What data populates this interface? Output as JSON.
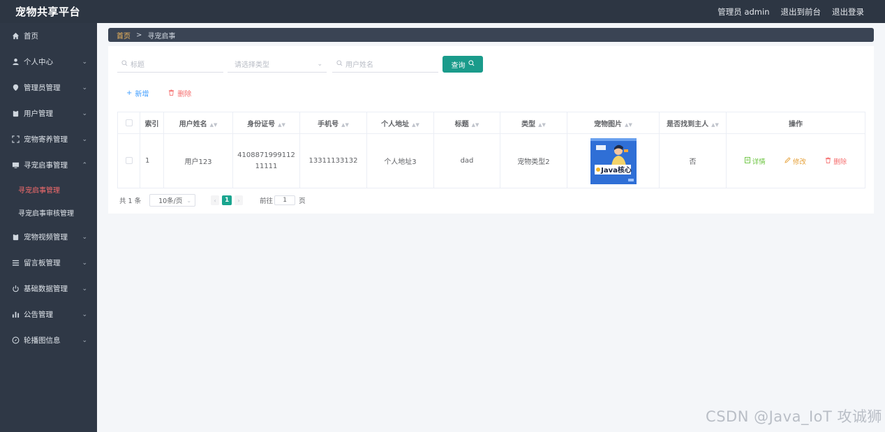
{
  "header": {
    "brand": "宠物共享平台",
    "user": "管理员 admin",
    "front": "退出到前台",
    "logout": "退出登录"
  },
  "sidebar": {
    "items": [
      {
        "label": "首页",
        "icon": "home-icon"
      },
      {
        "label": "个人中心",
        "icon": "user-icon"
      },
      {
        "label": "管理员管理",
        "icon": "shield-icon"
      },
      {
        "label": "用户管理",
        "icon": "clipboard-icon"
      },
      {
        "label": "宠物寄养管理",
        "icon": "expand-icon"
      },
      {
        "label": "寻宠启事管理",
        "icon": "monitor-icon"
      }
    ],
    "subitems": [
      {
        "label": "寻宠启事管理"
      },
      {
        "label": "寻宠启事审核管理"
      }
    ],
    "items_after": [
      {
        "label": "宠物视频管理",
        "icon": "clipboard-icon"
      },
      {
        "label": "留言板管理",
        "icon": "list-icon"
      },
      {
        "label": "基础数据管理",
        "icon": "power-icon"
      },
      {
        "label": "公告管理",
        "icon": "bar-chart-icon"
      },
      {
        "label": "轮播图信息",
        "icon": "compass-icon"
      }
    ]
  },
  "breadcrumb": {
    "home": "首页",
    "sep": ">",
    "current": "寻宠启事"
  },
  "search": {
    "title_placeholder": "标题",
    "type_placeholder": "请选择类型",
    "username_placeholder": "用户姓名",
    "query_label": "查询"
  },
  "actions": {
    "add": "新增",
    "delete": "删除"
  },
  "table": {
    "headers": [
      "索引",
      "用户姓名",
      "身份证号",
      "手机号",
      "个人地址",
      "标题",
      "类型",
      "宠物图片",
      "是否找到主人",
      "操作"
    ],
    "rows": [
      {
        "index": "1",
        "username": "用户123",
        "idcard": "410887199911211111",
        "phone": "13311133132",
        "address": "个人地址3",
        "title": "dad",
        "type": "宠物类型2",
        "image_caption": "Java核心",
        "found": "否",
        "op_detail": "详情",
        "op_edit": "修改",
        "op_delete": "删除"
      }
    ]
  },
  "pager": {
    "total": "共 1 条",
    "size": "10条/页",
    "current": "1",
    "goto_label": "前往",
    "goto_value": "1",
    "page_suffix": "页"
  },
  "watermark": "CSDN @Java_IoT 攻诚狮"
}
